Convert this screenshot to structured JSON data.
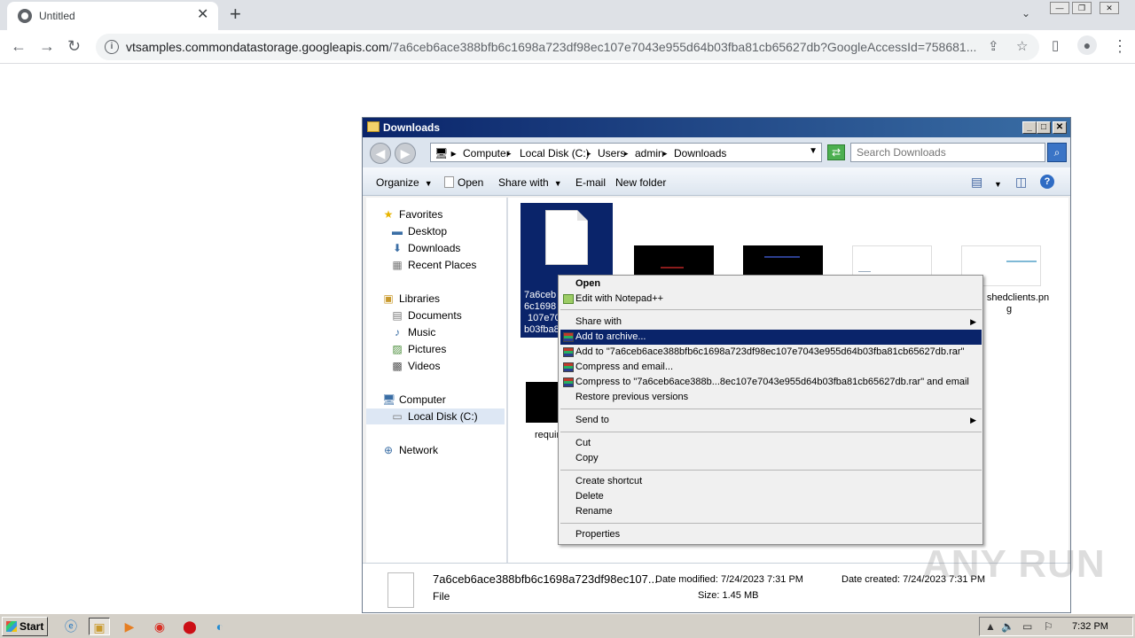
{
  "browser": {
    "tab_title": "Untitled",
    "url_host": "vtsamples.commondatastorage.googleapis.com",
    "url_path": "/7a6ceb6ace388bfb6c1698a723df98ec107e7043e955d64b03fba81cb65627db?GoogleAccessId=758681..."
  },
  "explorer": {
    "title": "Downloads",
    "breadcrumbs": [
      "Computer",
      "Local Disk (C:)",
      "Users",
      "admin",
      "Downloads"
    ],
    "search_placeholder": "Search Downloads",
    "commands": {
      "organize": "Organize",
      "open": "Open",
      "share_with": "Share with",
      "email": "E-mail",
      "new_folder": "New folder"
    },
    "nav": {
      "favorites": "Favorites",
      "desktop": "Desktop",
      "downloads": "Downloads",
      "recent_places": "Recent Places",
      "libraries": "Libraries",
      "documents": "Documents",
      "music": "Music",
      "pictures": "Pictures",
      "videos": "Videos",
      "computer": "Computer",
      "local_disk": "Local Disk (C:)",
      "network": "Network"
    },
    "files": {
      "selected_name_lines": [
        "7a6ceb",
        "6c1698",
        "107e70",
        "b03fba8"
      ],
      "fifth_name_lines": [
        "shedclients.pn",
        "g"
      ],
      "second_row_name": "requir"
    },
    "details": {
      "filename": "7a6ceb6ace388bfb6c1698a723df98ec107...",
      "type": "File",
      "date_modified": "Date modified: 7/24/2023 7:31 PM",
      "size": "Size: 1.45 MB",
      "date_created": "Date created: 7/24/2023 7:31 PM"
    }
  },
  "context_menu": {
    "open": "Open",
    "edit_notepad": "Edit with Notepad++",
    "share_with": "Share with",
    "add_archive": "Add to archive...",
    "add_to_rar": "Add to \"7a6ceb6ace388bfb6c1698a723df98ec107e7043e955d64b03fba81cb65627db.rar\"",
    "compress_email": "Compress and email...",
    "compress_to_email": "Compress to \"7a6ceb6ace388b...8ec107e7043e955d64b03fba81cb65627db.rar\" and email",
    "restore": "Restore previous versions",
    "send_to": "Send to",
    "cut": "Cut",
    "copy": "Copy",
    "create_shortcut": "Create shortcut",
    "delete": "Delete",
    "rename": "Rename",
    "properties": "Properties"
  },
  "taskbar": {
    "start": "Start",
    "clock": "7:32 PM"
  },
  "watermark": "ANY RUN"
}
